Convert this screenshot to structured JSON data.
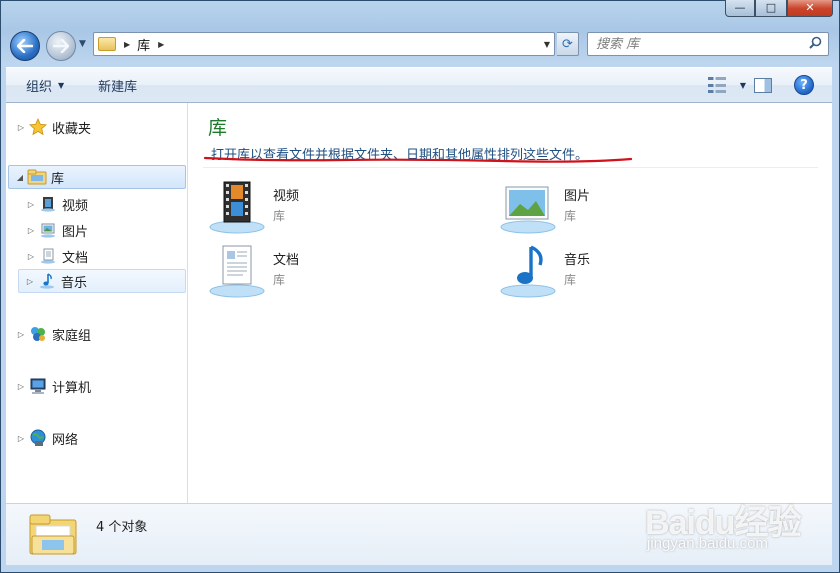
{
  "window": {
    "caption_buttons": {
      "minimize": "—",
      "maximize": "□",
      "close": "✕"
    }
  },
  "navigation": {
    "back_icon": "back-arrow-icon",
    "forward_icon": "forward-arrow-icon",
    "address": {
      "folder_icon": "library-folder-icon",
      "segments": [
        "库"
      ]
    },
    "search_placeholder": "搜索 库"
  },
  "command_bar": {
    "organize_label": "组织",
    "new_library_label": "新建库"
  },
  "nav_pane": {
    "favorites": "收藏夹",
    "libraries": "库",
    "library_children": [
      "视频",
      "图片",
      "文档",
      "音乐"
    ],
    "homegroup": "家庭组",
    "computer": "计算机",
    "network": "网络"
  },
  "content": {
    "title": "库",
    "description": "打开库以查看文件并根据文件夹、日期和其他属性排列这些文件。",
    "items": [
      {
        "name": "视频",
        "type": "库",
        "icon": "video-library-icon"
      },
      {
        "name": "图片",
        "type": "库",
        "icon": "picture-library-icon"
      },
      {
        "name": "文档",
        "type": "库",
        "icon": "document-library-icon"
      },
      {
        "name": "音乐",
        "type": "库",
        "icon": "music-library-icon"
      }
    ]
  },
  "details": {
    "count": "4 个对象"
  },
  "watermark": {
    "logo": "Baidu经验",
    "url": "jingyan.baidu.com"
  },
  "colors": {
    "title_green": "#1e7b2c",
    "desc_blue": "#1f4f80",
    "annotation_red": "#d0121b"
  }
}
